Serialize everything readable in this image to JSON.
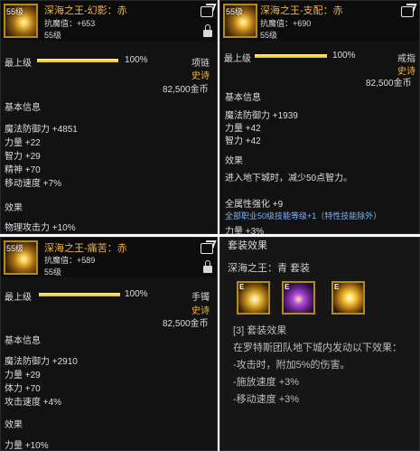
{
  "items": [
    {
      "level_badge": "55级",
      "name": "深海之王-幻影：赤",
      "magic_resist": "抗魔值：+653",
      "req_level": "55级",
      "top_grade_label": "最上级",
      "grade_percent_text": "100%",
      "grade_fraction": 1.0,
      "slot": "项链",
      "rarity": "史诗",
      "price": "82,500金币",
      "basic_info_header": "基本信息",
      "stats": [
        "魔法防御力 +4851",
        "力量 +22",
        "智力 +29",
        "精神 +70",
        "移动速度 +7%"
      ],
      "effect_header": "效果",
      "effects": [
        "物理攻击力 +10%"
      ]
    },
    {
      "level_badge": "55级",
      "name": "深海之王-支配：赤",
      "magic_resist": "抗魔值：+690",
      "req_level": "55级",
      "top_grade_label": "最上级",
      "grade_percent_text": "100%",
      "grade_fraction": 1.0,
      "slot": "戒指",
      "rarity": "史诗",
      "price": "82,500金币",
      "basic_info_header": "基本信息",
      "stats": [
        "魔法防御力 +1939",
        "力量 +42",
        "智力 +42"
      ],
      "effect_header": "效果",
      "effect_text": "进入地下城时，减少50点智力。",
      "all_attr": "全属性强化 +9",
      "skill_line": "全部职业50级技能等级+1（特性技能除外）",
      "extra": "力量 +3%"
    },
    {
      "level_badge": "55级",
      "name": "深海之王-痛苦：赤",
      "magic_resist": "抗魔值：+589",
      "req_level": "55级",
      "top_grade_label": "最上级",
      "grade_percent_text": "100%",
      "grade_fraction": 1.0,
      "slot": "手镯",
      "rarity": "史诗",
      "price": "82,500金币",
      "basic_info_header": "基本信息",
      "stats": [
        "魔法防御力 +2910",
        "力量 +29",
        "体力 +70",
        "攻击速度 +4%"
      ],
      "effect_header": "效果",
      "effects": [
        "力量 +10%"
      ]
    }
  ],
  "set": {
    "title": "套装效果",
    "name": "深海之王：青 套装",
    "icon_tags": [
      "E",
      "E",
      "E"
    ],
    "bonus_header": "[3] 套装效果",
    "desc": "在罗特斯团队地下城内发动以下效果：",
    "lines": [
      "-攻击时，附加5%的伤害。",
      "-施放速度 +3%",
      "-移动速度 +3%"
    ]
  },
  "icons": [
    "share-icon",
    "lock-icon"
  ],
  "colors": {
    "item_name": "#f0b640",
    "rarity": "#f0b640",
    "skill_text": "#7db4ff",
    "panel_bg": "#121212"
  }
}
